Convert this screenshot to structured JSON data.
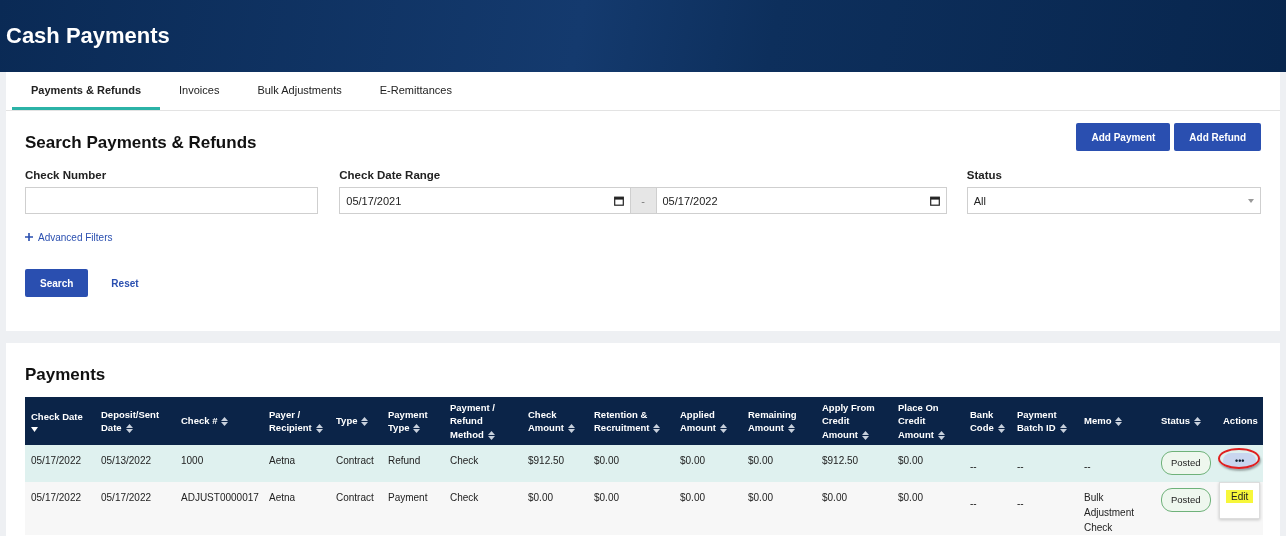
{
  "page_title": "Cash Payments",
  "tabs": [
    {
      "label": "Payments & Refunds",
      "selected": true
    },
    {
      "label": "Invoices",
      "selected": false
    },
    {
      "label": "Bulk Adjustments",
      "selected": false
    },
    {
      "label": "E-Remittances",
      "selected": false
    }
  ],
  "search": {
    "title": "Search Payments & Refunds",
    "buttons": [
      "Add Payment",
      "Add Refund"
    ],
    "check_number": {
      "label": "Check Number"
    },
    "check_date_range": {
      "label": "Check Date Range",
      "from": "05/17/2021",
      "separator": "-",
      "to": "05/17/2022"
    },
    "status": {
      "label": "Status",
      "value": "All"
    },
    "advanced_filters": "Advanced Filters",
    "search_button": "Search",
    "reset_link": "Reset"
  },
  "payments": {
    "title": "Payments",
    "columns": [
      {
        "label": "Check Date",
        "sortable": true,
        "sorted": true
      },
      {
        "label": "Deposit/Sent Date",
        "sortable": true,
        "sorted": false
      },
      {
        "label": "Check #",
        "sortable": true,
        "sorted": false
      },
      {
        "label": "Payer / Recipient",
        "sortable": true,
        "sorted": false
      },
      {
        "label": "Type",
        "sortable": true,
        "sorted": false
      },
      {
        "label": "Payment Type",
        "sortable": true,
        "sorted": false
      },
      {
        "label": "Payment / Refund Method",
        "sortable": true,
        "sorted": false
      },
      {
        "label": "Check Amount",
        "sortable": true,
        "sorted": false
      },
      {
        "label": "Retention & Recruitment",
        "sortable": true,
        "sorted": false
      },
      {
        "label": "Applied Amount",
        "sortable": true,
        "sorted": false
      },
      {
        "label": "Remaining Amount",
        "sortable": true,
        "sorted": false
      },
      {
        "label": "Apply From Credit Amount",
        "sortable": true,
        "sorted": false
      },
      {
        "label": "Place On Credit Amount",
        "sortable": true,
        "sorted": false
      },
      {
        "label": "Bank Code",
        "sortable": true,
        "sorted": false
      },
      {
        "label": "Payment Batch ID",
        "sortable": true,
        "sorted": false
      },
      {
        "label": "Memo",
        "sortable": true,
        "sorted": false
      },
      {
        "label": "Status",
        "sortable": true,
        "sorted": false
      },
      {
        "label": "Actions",
        "sortable": false,
        "sorted": false
      }
    ],
    "rows": [
      {
        "selected": true,
        "cells": [
          "05/17/2022",
          "05/13/2022",
          "1000",
          "Aetna",
          "Contract",
          "Refund",
          "Check",
          "$912.50",
          "$0.00",
          "$0.00",
          "$0.00",
          "$912.50",
          "$0.00",
          "--",
          "--",
          "--"
        ],
        "status": "Posted",
        "actions": "•••",
        "menu_open": false,
        "circled": true
      },
      {
        "selected": false,
        "cells": [
          "05/17/2022",
          "05/17/2022",
          "ADJUST0000017",
          "Aetna",
          "Contract",
          "Payment",
          "Check",
          "$0.00",
          "$0.00",
          "$0.00",
          "$0.00",
          "$0.00",
          "$0.00",
          "--",
          "--",
          "Bulk Adjustment Check"
        ],
        "status": "Posted",
        "menu_open": true,
        "menu_item": "Edit"
      }
    ]
  }
}
